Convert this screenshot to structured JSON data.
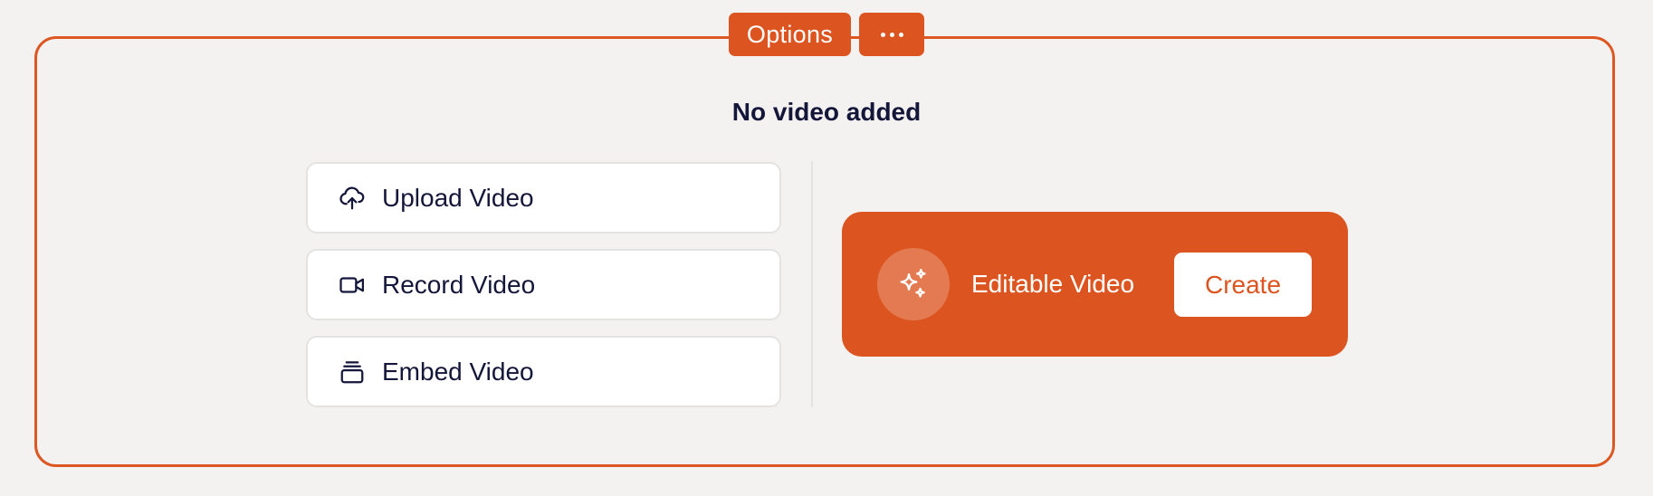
{
  "toolbar": {
    "options_label": "Options",
    "more_icon": "more-horizontal-icon"
  },
  "heading": "No video added",
  "video_options": [
    {
      "label": "Upload Video",
      "icon": "upload-cloud-icon"
    },
    {
      "label": "Record Video",
      "icon": "video-camera-icon"
    },
    {
      "label": "Embed Video",
      "icon": "embed-stack-icon"
    }
  ],
  "promo": {
    "label": "Editable Video",
    "icon": "sparkles-icon",
    "button_label": "Create"
  },
  "colors": {
    "accent": "#dc5520",
    "text_dark": "#14163a",
    "background": "#f4f2f0",
    "card": "#ffffff",
    "border": "#e5e3e1"
  }
}
